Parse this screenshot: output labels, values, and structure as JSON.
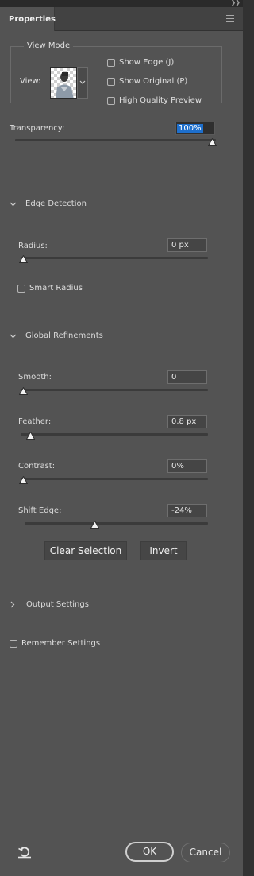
{
  "header": {
    "tab_label": "Properties",
    "collapse_icon": "double-chevron-right-icon",
    "menu_icon": "hamburger-menu-icon"
  },
  "view_mode": {
    "legend": "View Mode",
    "view_label": "View:",
    "options": [
      {
        "label": "Show Edge (J)",
        "checked": false
      },
      {
        "label": "Show Original (P)",
        "checked": false
      },
      {
        "label": "High Quality Preview",
        "checked": false
      }
    ]
  },
  "transparency": {
    "label": "Transparency:",
    "value": "100%",
    "level": 1.0
  },
  "edge_detection": {
    "title": "Edge Detection",
    "expanded": true,
    "radius": {
      "label": "Radius:",
      "value": "0 px",
      "level": 0.0
    },
    "smart_radius": {
      "label": "Smart Radius",
      "checked": false
    }
  },
  "global_refinements": {
    "title": "Global Refinements",
    "expanded": true,
    "smooth": {
      "label": "Smooth:",
      "value": "0",
      "level": 0.0
    },
    "feather": {
      "label": "Feather:",
      "value": "0.8 px",
      "level": 0.04
    },
    "contrast": {
      "label": "Contrast:",
      "value": "0%",
      "level": 0.0
    },
    "shift_edge": {
      "label": "Shift Edge:",
      "value": "-24%",
      "level": 0.38
    },
    "clear_selection_label": "Clear Selection",
    "invert_label": "Invert"
  },
  "output_settings": {
    "title": "Output Settings",
    "expanded": false
  },
  "remember_settings": {
    "label": "Remember Settings",
    "checked": false
  },
  "footer": {
    "reset_icon": "reset-icon",
    "ok_label": "OK",
    "cancel_label": "Cancel"
  },
  "colors": {
    "panel_bg": "#535353",
    "selection_highlight": "#1e6fcc",
    "track": "#3b3b3b"
  }
}
